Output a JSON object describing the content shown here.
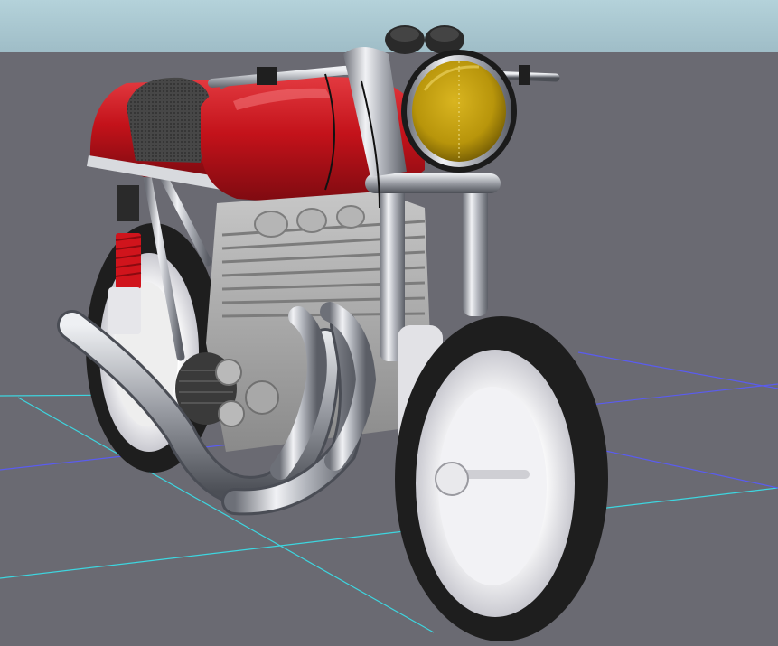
{
  "viewport": {
    "sky_color": "#a8c6cf",
    "ground_color": "#6a6a72",
    "grid_color_x": "#3dd6e0",
    "grid_color_z": "#5a5cf0"
  },
  "model": {
    "tank_color": "#c4121a",
    "seat_color": "#3d3d3d",
    "headlight_lens_color": "#c8a510",
    "shock_spring_color": "#d0141c",
    "tire_color": "#262626",
    "rim_color": "#e4e4ea",
    "chrome_color": "#c9ccd2",
    "engine_color": "#a7a7a7"
  },
  "icons": {
    "headlight": "headlight-icon",
    "gauges": "gauge-icon"
  }
}
